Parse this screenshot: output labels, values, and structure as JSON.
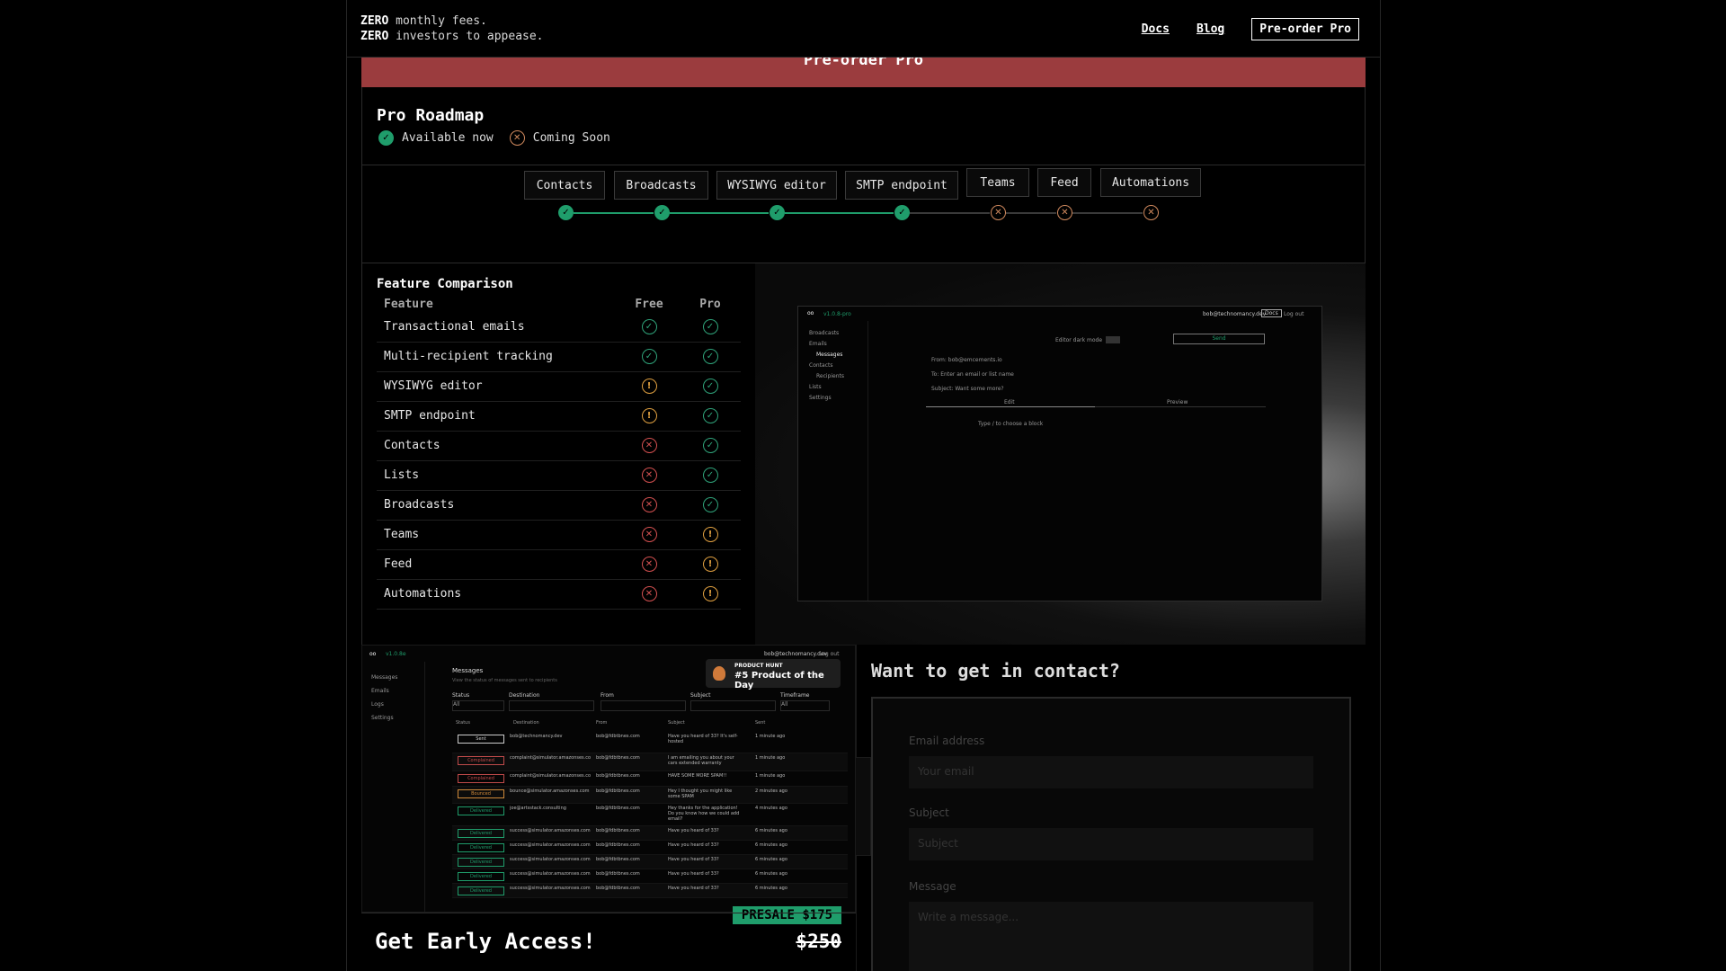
{
  "header": {
    "tagline_line1_bold": "ZERO",
    "tagline_line1_rest": " monthly fees.",
    "tagline_line2_bold": "ZERO",
    "tagline_line2_rest": " investors to appease.",
    "nav_docs": "Docs",
    "nav_blog": "Blog",
    "nav_preorder": "Pre-order Pro"
  },
  "banner": {
    "text": "Pre-order Pro"
  },
  "roadmap": {
    "title": "Pro Roadmap",
    "legend_available": "Available now",
    "legend_coming": "Coming Soon",
    "stages": [
      {
        "label": "Contacts",
        "status": "available"
      },
      {
        "label": "Broadcasts",
        "status": "available"
      },
      {
        "label": "WYSIWYG editor",
        "status": "available"
      },
      {
        "label": "SMTP endpoint",
        "status": "available"
      },
      {
        "label": "Teams",
        "status": "coming"
      },
      {
        "label": "Feed",
        "status": "coming"
      },
      {
        "label": "Automations",
        "status": "coming"
      }
    ]
  },
  "comparison": {
    "title": "Feature Comparison",
    "col_feature": "Feature",
    "col_free": "Free",
    "col_pro": "Pro",
    "rows": [
      {
        "feature": "Transactional emails",
        "free": "yes",
        "pro": "yes"
      },
      {
        "feature": "Multi-recipient tracking",
        "free": "yes",
        "pro": "yes"
      },
      {
        "feature": "WYSIWYG editor",
        "free": "limited",
        "pro": "yes"
      },
      {
        "feature": "SMTP endpoint",
        "free": "limited",
        "pro": "yes"
      },
      {
        "feature": "Contacts",
        "free": "no",
        "pro": "yes"
      },
      {
        "feature": "Lists",
        "free": "no",
        "pro": "yes"
      },
      {
        "feature": "Broadcasts",
        "free": "no",
        "pro": "yes"
      },
      {
        "feature": "Teams",
        "free": "no",
        "pro": "limited"
      },
      {
        "feature": "Feed",
        "free": "no",
        "pro": "limited"
      },
      {
        "feature": "Automations",
        "free": "no",
        "pro": "limited"
      }
    ]
  },
  "screenshot_editor": {
    "version": "v1.0.8-pro",
    "user": "bob@technomancy.dev",
    "docs": "Docs",
    "logout": "Log out",
    "nav": [
      "Broadcasts",
      "Emails",
      "Messages",
      "Contacts",
      "Recipients",
      "Lists",
      "Settings"
    ],
    "editor_dark_mode": "Editor dark mode",
    "send": "Send",
    "from": "From: bob@emcements.io",
    "to": "To: Enter an email or list name",
    "subject": "Subject: Want some more?",
    "edit_tab": "Edit",
    "preview_tab": "Preview",
    "hint": "Type / to choose a block"
  },
  "screenshot_messages": {
    "version": "v1.0.8e",
    "user": "bob@technomancy.dev",
    "logout": "Log out",
    "nav": [
      "Messages",
      "Emails",
      "Logs",
      "Settings"
    ],
    "title": "Messages",
    "subtitle": "View the status of messages sent to recipients",
    "filters": [
      "Status",
      "Destination",
      "From",
      "Subject",
      "Timeframe"
    ],
    "filter_all": "All",
    "columns": [
      "Status",
      "Destination",
      "From",
      "Subject",
      "Sent"
    ],
    "rows": [
      {
        "status": "Sent",
        "tone": "white",
        "dest": "bob@technomancy.dev",
        "from": "bob@fdbtbnes.com",
        "subject": "Have you heard of 33? It's self-hosted",
        "sent": "1 minute ago"
      },
      {
        "status": "Complained",
        "tone": "red",
        "dest": "complaint@simulator.amazonses.com",
        "from": "bob@fdbtbnes.com",
        "subject": "I am emailing you about your cars extended warranty",
        "sent": "1 minute ago"
      },
      {
        "status": "Complained",
        "tone": "red",
        "dest": "complaint@simulator.amazonses.com",
        "from": "bob@fdbtbnes.com",
        "subject": "HAVE SOME MORE SPAM!!",
        "sent": "1 minute ago"
      },
      {
        "status": "Bounced",
        "tone": "orange",
        "dest": "bounce@simulator.amazonses.com",
        "from": "bob@fdbtbnes.com",
        "subject": "Hey I thought you might like some SPAM",
        "sent": "2 minutes ago"
      },
      {
        "status": "Delivered",
        "tone": "green",
        "dest": "joe@artsstack.consulting",
        "from": "bob@fdbtbnes.com",
        "subject": "Hey thanks for the application! Do you know how we could add email?",
        "sent": "4 minutes ago"
      },
      {
        "status": "Delivered",
        "tone": "green",
        "dest": "success@simulator.amazonses.com",
        "from": "bob@fdbtbnes.com",
        "subject": "Have you heard of 33?",
        "sent": "6 minutes ago"
      },
      {
        "status": "Delivered",
        "tone": "green",
        "dest": "success@simulator.amazonses.com",
        "from": "bob@fdbtbnes.com",
        "subject": "Have you heard of 33?",
        "sent": "6 minutes ago"
      },
      {
        "status": "Delivered",
        "tone": "green",
        "dest": "success@simulator.amazonses.com",
        "from": "bob@fdbtbnes.com",
        "subject": "Have you heard of 33?",
        "sent": "6 minutes ago"
      },
      {
        "status": "Delivered",
        "tone": "green",
        "dest": "success@simulator.amazonses.com",
        "from": "bob@fdbtbnes.com",
        "subject": "Have you heard of 33?",
        "sent": "6 minutes ago"
      },
      {
        "status": "Delivered",
        "tone": "green",
        "dest": "success@simulator.amazonses.com",
        "from": "bob@fdbtbnes.com",
        "subject": "Have you heard of 33?",
        "sent": "6 minutes ago"
      }
    ],
    "product_hunt_label": "PRODUCT HUNT",
    "product_hunt_rank": "#5 Product of the Day"
  },
  "early_access": {
    "presale": "PRESALE $175",
    "title": "Get Early Access!",
    "old_price": "$250"
  },
  "contact": {
    "title": "Want to get in contact?",
    "email_label": "Email address",
    "email_placeholder": "Your email",
    "subject_label": "Subject",
    "subject_placeholder": "Subject",
    "message_label": "Message",
    "message_placeholder": "Write a message..."
  },
  "colors": {
    "accent": "#1f9d6b",
    "banner": "#9b3c3e",
    "error": "#d45050",
    "warning": "#e0a040"
  }
}
